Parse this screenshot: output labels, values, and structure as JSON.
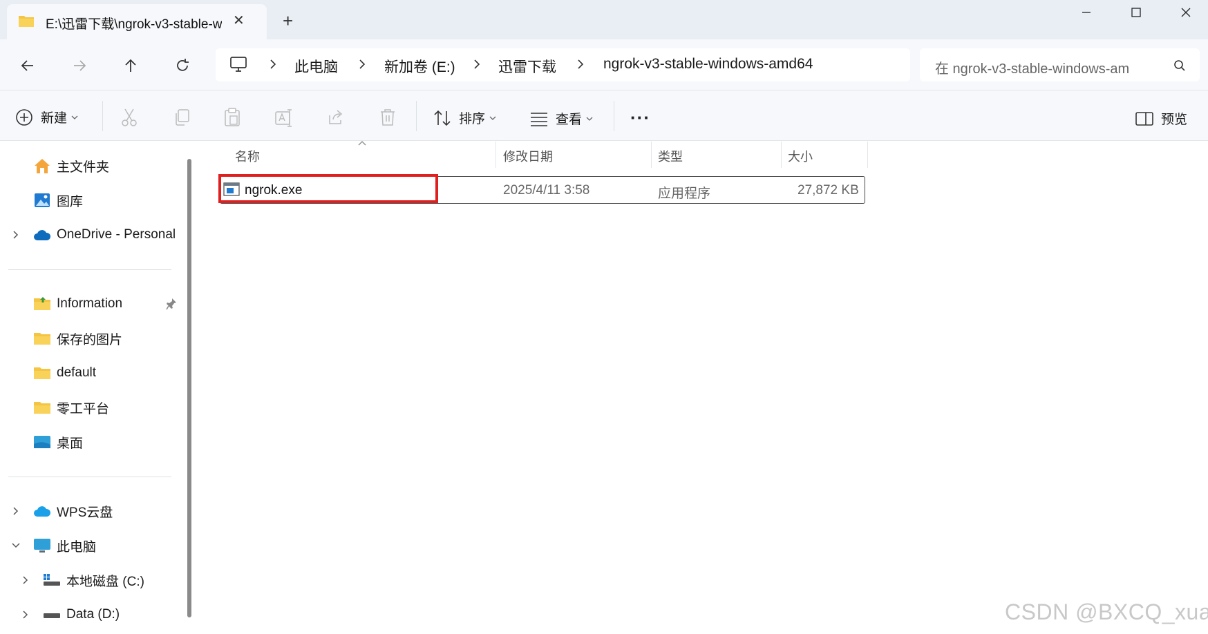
{
  "window": {
    "tab_title": "E:\\迅雷下载\\ngrok-v3-stable-w",
    "tab_close": "✕",
    "new_tab": "+",
    "minimize": "—",
    "maximize": "▢",
    "close": "✕"
  },
  "address": {
    "breadcrumbs": [
      "此电脑",
      "新加卷 (E:)",
      "迅雷下载",
      "ngrok-v3-stable-windows-amd64"
    ],
    "search_placeholder": "在 ngrok-v3-stable-windows-am"
  },
  "toolbar": {
    "new_label": "新建",
    "sort_label": "排序",
    "view_label": "查看",
    "more_label": "···",
    "preview_label": "预览"
  },
  "sidebar": {
    "quick": [
      {
        "label": "主文件夹",
        "icon": "home-icon"
      },
      {
        "label": "图库",
        "icon": "gallery-icon"
      },
      {
        "label": "OneDrive - Personal",
        "icon": "onedrive-icon"
      }
    ],
    "pinned": [
      {
        "label": "Information",
        "icon": "folder-icon"
      },
      {
        "label": "保存的图片",
        "icon": "folder-icon"
      },
      {
        "label": "default",
        "icon": "folder-icon"
      },
      {
        "label": "零工平台",
        "icon": "folder-icon"
      },
      {
        "label": "桌面",
        "icon": "desktop-icon"
      }
    ],
    "devices": [
      {
        "label": "WPS云盘",
        "icon": "wps-cloud-icon"
      },
      {
        "label": "此电脑",
        "icon": "this-pc-icon"
      },
      {
        "label": "本地磁盘 (C:)",
        "icon": "drive-icon"
      },
      {
        "label": "Data (D:)",
        "icon": "drive-icon"
      }
    ]
  },
  "columns": {
    "name": "名称",
    "modified": "修改日期",
    "type": "类型",
    "size": "大小"
  },
  "files": [
    {
      "name": "ngrok.exe",
      "modified": "2025/4/11 3:58",
      "type": "应用程序",
      "size": "27,872 KB"
    }
  ],
  "colors": {
    "highlight_box": "#e0201f",
    "folder": "#f4c542",
    "accent": "#0067c0"
  },
  "watermark": "CSDN @BXCQ_xuan"
}
